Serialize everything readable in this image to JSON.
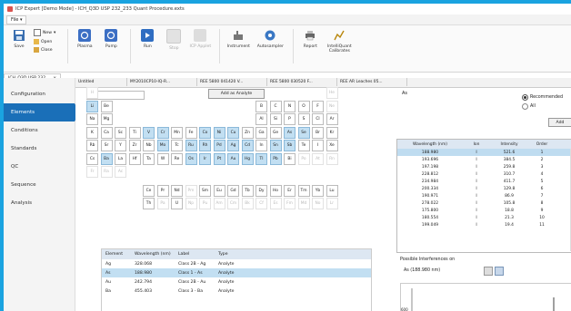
{
  "window": {
    "title": "ICP Expert [Demo Mode] - ICH_Q3D USP 232_233 Quant Procedure.exts"
  },
  "filebar": {
    "file_label": "File"
  },
  "ribbon": {
    "save": "Save",
    "new": "New",
    "open": "Open",
    "close": "Close",
    "plasma": "Plasma",
    "pump": "Pump",
    "run": "Run",
    "stop": "Stop",
    "icp_applet": "ICP Applet",
    "instrument": "Instrument",
    "autosampler": "Autosampler",
    "report": "Report",
    "intelliquant": "IntelliQuant",
    "calibrates": "Calibrates"
  },
  "doc_tabs": [
    "ICH_Q3D USP 232_..."
  ],
  "page_tabs": [
    "Untitled",
    "MY2010CP10-IQ-R...",
    "REE 5800 041420 V...",
    "REE 5800 030520 F...",
    "REE AR Leaches 05..."
  ],
  "nav": [
    "Configuration",
    "Elements",
    "Conditions",
    "Standards",
    "QC",
    "Sequence",
    "Analysis"
  ],
  "active_nav": "Elements",
  "periodic": {
    "search_value": "H",
    "add_button": "Add as Analyte",
    "rows": [
      {
        "r": 0,
        "cells": [
          {
            "c": 0,
            "s": "H",
            "st": "dim"
          },
          {
            "c": 17,
            "s": "He",
            "st": "dim"
          }
        ]
      },
      {
        "r": 1,
        "cells": [
          {
            "c": 0,
            "s": "Li",
            "st": "sel"
          },
          {
            "c": 1,
            "s": "Be",
            "st": "n"
          },
          {
            "c": 12,
            "s": "B",
            "st": "n"
          },
          {
            "c": 13,
            "s": "C",
            "st": "n"
          },
          {
            "c": 14,
            "s": "N",
            "st": "n"
          },
          {
            "c": 15,
            "s": "O",
            "st": "n"
          },
          {
            "c": 16,
            "s": "F",
            "st": "n"
          },
          {
            "c": 17,
            "s": "Ne",
            "st": "dim"
          }
        ]
      },
      {
        "r": 2,
        "cells": [
          {
            "c": 0,
            "s": "Na",
            "st": "n"
          },
          {
            "c": 1,
            "s": "Mg",
            "st": "n"
          },
          {
            "c": 12,
            "s": "Al",
            "st": "n"
          },
          {
            "c": 13,
            "s": "Si",
            "st": "n"
          },
          {
            "c": 14,
            "s": "P",
            "st": "n"
          },
          {
            "c": 15,
            "s": "S",
            "st": "n"
          },
          {
            "c": 16,
            "s": "Cl",
            "st": "n"
          },
          {
            "c": 17,
            "s": "Ar",
            "st": "n"
          }
        ]
      },
      {
        "r": 3,
        "cells": [
          {
            "c": 0,
            "s": "K",
            "st": "n"
          },
          {
            "c": 1,
            "s": "Ca",
            "st": "n"
          },
          {
            "c": 2,
            "s": "Sc",
            "st": "n"
          },
          {
            "c": 3,
            "s": "Ti",
            "st": "n"
          },
          {
            "c": 4,
            "s": "V",
            "st": "sel"
          },
          {
            "c": 5,
            "s": "Cr",
            "st": "sel"
          },
          {
            "c": 6,
            "s": "Mn",
            "st": "n"
          },
          {
            "c": 7,
            "s": "Fe",
            "st": "n"
          },
          {
            "c": 8,
            "s": "Co",
            "st": "sel"
          },
          {
            "c": 9,
            "s": "Ni",
            "st": "sel"
          },
          {
            "c": 10,
            "s": "Cu",
            "st": "sel"
          },
          {
            "c": 11,
            "s": "Zn",
            "st": "n"
          },
          {
            "c": 12,
            "s": "Ga",
            "st": "n"
          },
          {
            "c": 13,
            "s": "Ge",
            "st": "n"
          },
          {
            "c": 14,
            "s": "As",
            "st": "sel"
          },
          {
            "c": 15,
            "s": "Se",
            "st": "sel"
          },
          {
            "c": 16,
            "s": "Br",
            "st": "n"
          },
          {
            "c": 17,
            "s": "Kr",
            "st": "n"
          }
        ]
      },
      {
        "r": 4,
        "cells": [
          {
            "c": 0,
            "s": "Rb",
            "st": "n"
          },
          {
            "c": 1,
            "s": "Sr",
            "st": "n"
          },
          {
            "c": 2,
            "s": "Y",
            "st": "n"
          },
          {
            "c": 3,
            "s": "Zr",
            "st": "n"
          },
          {
            "c": 4,
            "s": "Nb",
            "st": "n"
          },
          {
            "c": 5,
            "s": "Mo",
            "st": "sel"
          },
          {
            "c": 6,
            "s": "Tc",
            "st": "n"
          },
          {
            "c": 7,
            "s": "Ru",
            "st": "sel"
          },
          {
            "c": 8,
            "s": "Rh",
            "st": "sel"
          },
          {
            "c": 9,
            "s": "Pd",
            "st": "sel"
          },
          {
            "c": 10,
            "s": "Ag",
            "st": "sel"
          },
          {
            "c": 11,
            "s": "Cd",
            "st": "sel"
          },
          {
            "c": 12,
            "s": "In",
            "st": "n"
          },
          {
            "c": 13,
            "s": "Sn",
            "st": "sel"
          },
          {
            "c": 14,
            "s": "Sb",
            "st": "sel"
          },
          {
            "c": 15,
            "s": "Te",
            "st": "n"
          },
          {
            "c": 16,
            "s": "I",
            "st": "n"
          },
          {
            "c": 17,
            "s": "Xe",
            "st": "n"
          }
        ]
      },
      {
        "r": 5,
        "cells": [
          {
            "c": 0,
            "s": "Cs",
            "st": "n"
          },
          {
            "c": 1,
            "s": "Ba",
            "st": "sel"
          },
          {
            "c": 2,
            "s": "La",
            "st": "n"
          },
          {
            "c": 3,
            "s": "Hf",
            "st": "n"
          },
          {
            "c": 4,
            "s": "Ta",
            "st": "n"
          },
          {
            "c": 5,
            "s": "W",
            "st": "n"
          },
          {
            "c": 6,
            "s": "Re",
            "st": "n"
          },
          {
            "c": 7,
            "s": "Os",
            "st": "sel"
          },
          {
            "c": 8,
            "s": "Ir",
            "st": "sel"
          },
          {
            "c": 9,
            "s": "Pt",
            "st": "sel"
          },
          {
            "c": 10,
            "s": "Au",
            "st": "sel"
          },
          {
            "c": 11,
            "s": "Hg",
            "st": "sel"
          },
          {
            "c": 12,
            "s": "Tl",
            "st": "sel"
          },
          {
            "c": 13,
            "s": "Pb",
            "st": "sel"
          },
          {
            "c": 14,
            "s": "Bi",
            "st": "n"
          },
          {
            "c": 15,
            "s": "Po",
            "st": "dim"
          },
          {
            "c": 16,
            "s": "At",
            "st": "dim"
          },
          {
            "c": 17,
            "s": "Rn",
            "st": "dim"
          }
        ]
      },
      {
        "r": 6,
        "cells": [
          {
            "c": 0,
            "s": "Fr",
            "st": "dim"
          },
          {
            "c": 1,
            "s": "Ra",
            "st": "dim"
          },
          {
            "c": 2,
            "s": "Ac",
            "st": "dim"
          }
        ]
      },
      {
        "r": 7,
        "cells": [
          {
            "c": 4,
            "s": "Ce",
            "st": "n"
          },
          {
            "c": 5,
            "s": "Pr",
            "st": "n"
          },
          {
            "c": 6,
            "s": "Nd",
            "st": "n"
          },
          {
            "c": 7,
            "s": "Pm",
            "st": "dim"
          },
          {
            "c": 8,
            "s": "Sm",
            "st": "n"
          },
          {
            "c": 9,
            "s": "Eu",
            "st": "n"
          },
          {
            "c": 10,
            "s": "Gd",
            "st": "n"
          },
          {
            "c": 11,
            "s": "Tb",
            "st": "n"
          },
          {
            "c": 12,
            "s": "Dy",
            "st": "n"
          },
          {
            "c": 13,
            "s": "Ho",
            "st": "n"
          },
          {
            "c": 14,
            "s": "Er",
            "st": "n"
          },
          {
            "c": 15,
            "s": "Tm",
            "st": "n"
          },
          {
            "c": 16,
            "s": "Yb",
            "st": "n"
          },
          {
            "c": 17,
            "s": "Lu",
            "st": "n"
          }
        ]
      },
      {
        "r": 8,
        "cells": [
          {
            "c": 4,
            "s": "Th",
            "st": "n"
          },
          {
            "c": 5,
            "s": "Pa",
            "st": "dim"
          },
          {
            "c": 6,
            "s": "U",
            "st": "n"
          },
          {
            "c": 7,
            "s": "Np",
            "st": "dim"
          },
          {
            "c": 8,
            "s": "Pu",
            "st": "dim"
          },
          {
            "c": 9,
            "s": "Am",
            "st": "dim"
          },
          {
            "c": 10,
            "s": "Cm",
            "st": "dim"
          },
          {
            "c": 11,
            "s": "Bk",
            "st": "dim"
          },
          {
            "c": 12,
            "s": "Cf",
            "st": "dim"
          },
          {
            "c": 13,
            "s": "Es",
            "st": "dim"
          },
          {
            "c": 14,
            "s": "Fm",
            "st": "dim"
          },
          {
            "c": 15,
            "s": "Md",
            "st": "dim"
          },
          {
            "c": 16,
            "s": "No",
            "st": "dim"
          },
          {
            "c": 17,
            "s": "Lr",
            "st": "dim"
          }
        ]
      }
    ]
  },
  "elements_table": {
    "headers": [
      "Element",
      "Wavelength (nm)",
      "Label",
      "Type"
    ],
    "rows": [
      {
        "element": "Ag",
        "wavelength": "328.068",
        "label": "Class 2B - Ag",
        "type": "Analyte",
        "hl": false
      },
      {
        "element": "As",
        "wavelength": "188.980",
        "label": "Class 1 - As",
        "type": "Analyte",
        "hl": true
      },
      {
        "element": "Au",
        "wavelength": "242.794",
        "label": "Class 2B - Au",
        "type": "Analyte",
        "hl": false
      },
      {
        "element": "Ba",
        "wavelength": "455.403",
        "label": "Class 3 - Ba",
        "type": "Analyte",
        "hl": false
      }
    ]
  },
  "right_panel": {
    "element_label": "As",
    "recommended": "Recommended",
    "all": "All",
    "add_button": "Add",
    "headers": [
      "Wavelength (nm)",
      "Ion",
      "Intensity",
      "Order"
    ],
    "rows": [
      {
        "wl": "188.980",
        "ion": "I",
        "int": "521.6",
        "ord": "1"
      },
      {
        "wl": "193.696",
        "ion": "I",
        "int": "384.5",
        "ord": "2"
      },
      {
        "wl": "197.198",
        "ion": "I",
        "int": "259.8",
        "ord": "3"
      },
      {
        "wl": "228.812",
        "ion": "I",
        "int": "310.7",
        "ord": "4"
      },
      {
        "wl": "234.984",
        "ion": "I",
        "int": "411.7",
        "ord": "5"
      },
      {
        "wl": "200.334",
        "ion": "I",
        "int": "129.8",
        "ord": "6"
      },
      {
        "wl": "190.971",
        "ion": "I",
        "int": "86.9",
        "ord": "7"
      },
      {
        "wl": "278.022",
        "ion": "I",
        "int": "105.8",
        "ord": "8"
      },
      {
        "wl": "175.800",
        "ion": "I",
        "int": "18.8",
        "ord": "9"
      },
      {
        "wl": "180.554",
        "ion": "I",
        "int": "21.3",
        "ord": "10"
      },
      {
        "wl": "199.049",
        "ion": "I",
        "int": "19.4",
        "ord": "11"
      }
    ],
    "interferences_label": "Possible Interferences on",
    "interference_line": "As (188.980 nm)",
    "y_tick": "600"
  },
  "colors": {
    "accent": "#1a6fb8",
    "selected": "#c2dff2",
    "frame": "#1aa3e0"
  }
}
